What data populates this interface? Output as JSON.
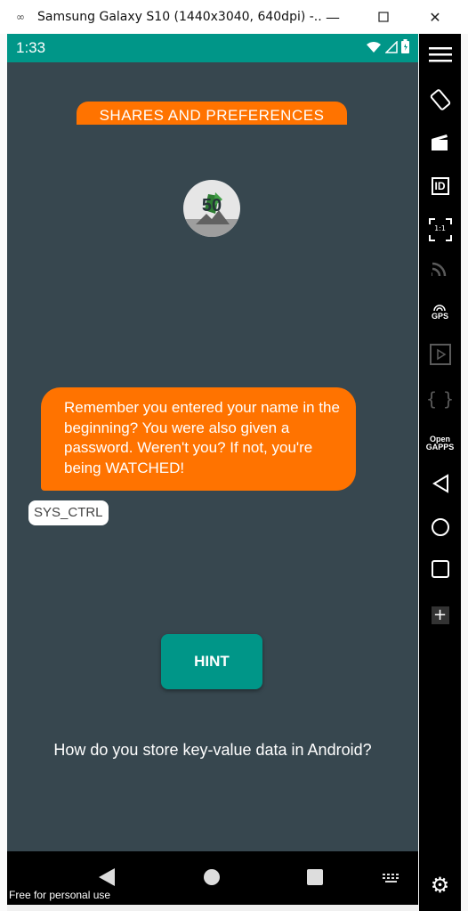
{
  "window": {
    "title": "Samsung Galaxy S10 (1440x3040, 640dpi) -...",
    "minimize_icon": "minimize-icon",
    "maximize_icon": "maximize-icon",
    "close_icon": "close-icon"
  },
  "status_bar": {
    "time": "1:33",
    "icons": [
      "wifi-icon",
      "signal-icon",
      "battery-icon"
    ],
    "color": "#009688"
  },
  "screen": {
    "header": "SHARES AND PREFERENCES",
    "badge_number": "50",
    "message": "Remember you entered your name in the beginning? You were also given a password. Weren't you? If not, you're being WATCHED!",
    "sender": "SYS_CTRL",
    "hint_button": "HINT",
    "question": "How do you store key-value data in Android?",
    "background_color": "#37474f",
    "accent_orange": "#ff7300",
    "accent_teal": "#009688"
  },
  "nav_bar": {
    "buttons": [
      "back-icon",
      "home-icon",
      "recents-icon",
      "keyboard-icon"
    ]
  },
  "watermark": "Free for personal use",
  "toolbar": {
    "items": [
      "menu-icon",
      "rotate-icon",
      "screen-record-icon",
      "device-id-icon",
      "fit-1to1-icon",
      "cast-icon",
      "gps-icon",
      "media-icon",
      "developer-icon",
      "opengapps-icon",
      "back-icon",
      "home-icon",
      "recents-icon",
      "add-icon",
      "settings-icon"
    ],
    "gps_label": "GPS",
    "opengapps_label": "Open GAPPS",
    "fit_label": "1:1",
    "id_label": "ID"
  }
}
